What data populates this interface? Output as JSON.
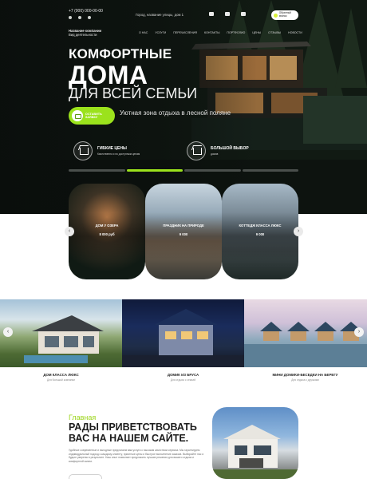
{
  "header": {
    "phone": "+7 (000) 000-00-00",
    "address": "Город, название улицы, дом 1",
    "call_button": "Обратный звонок",
    "company_name": "Название компании",
    "company_desc": "Вид деятельности"
  },
  "nav": [
    "О НАС",
    "УСЛУГИ",
    "ПЕРЕЧИСЛЕНИЯ",
    "КОНТАКТЫ",
    "ПОРТФОЛИО",
    "ЦЕНЫ",
    "ОТЗЫВЫ",
    "НОВОСТИ"
  ],
  "hero": {
    "line1": "КОМФОРТНЫЕ",
    "line2": "ДОМА",
    "line3": "ДЛЯ ВСЕЙ СЕМЬИ",
    "cta": "ОСТАВИТЬ ЗАЯВКУ",
    "tagline": "Уютная зона отдыха в лесной поляне"
  },
  "features": [
    {
      "title": "ГИБКИЕ ЦЕНЫ",
      "desc": "Качественно и по доступным ценам",
      "icon": "house-icon"
    },
    {
      "title": "БОЛЬШОЙ ВЫБОР",
      "desc": "домов",
      "icon": "house-lock-icon"
    }
  ],
  "slider": {
    "active_index": 1,
    "count": 4
  },
  "cards": [
    {
      "label": "ДОМ У ОЗЕРА",
      "price": "8 000 руб"
    },
    {
      "label": "ПРАЗДНИК НА ПРИРОДЕ",
      "price": "9 000"
    },
    {
      "label": "КОТТЕДЖ КЛАССА ЛЮКС",
      "price": "9 000"
    }
  ],
  "gallery": [
    {
      "title": "ДОМ КЛАССА ЛЮКС",
      "desc": "Для большой компании"
    },
    {
      "title": "ДОМИК ИЗ БРУСА",
      "desc": "Для отдыха с семьей"
    },
    {
      "title": "МИНИ ДОМИКИ-БЕСЕДКИ НА БЕРЕГУ",
      "desc": "Для отдыха с друзьями"
    }
  ],
  "welcome": {
    "subtitle": "Главная",
    "title": "РАДЫ ПРИВЕТСТВОВАТЬ ВАС НА НАШЕМ САЙТЕ.",
    "text": "Удобные современные и выгодные предлагаем вам услуги с высоким качеством сервиса. Мы гарантируем индивидуальный подход к каждому клиенту, приятные цены и быстрое выполнение заказов. Выбирайте нас и будьте уверены в результате. Наш опыт позволяет предложить лучшие решения для вашего отдыха и комфортной жизни."
  },
  "colors": {
    "accent": "#9be21c",
    "dark": "#0f1410"
  }
}
